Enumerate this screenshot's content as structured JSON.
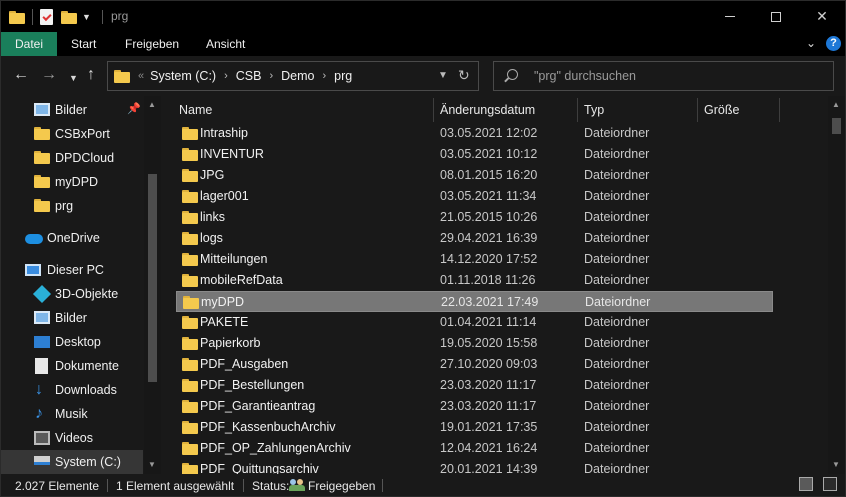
{
  "window": {
    "title": "prg",
    "min_label": "",
    "max_label": "",
    "close_label": "✕"
  },
  "ribbon": {
    "tabs": [
      {
        "label": "Datei",
        "active": true
      },
      {
        "label": "Start"
      },
      {
        "label": "Freigeben"
      },
      {
        "label": "Ansicht"
      }
    ],
    "help": "?"
  },
  "address": {
    "overflow": "«",
    "crumbs": [
      "System (C:)",
      "CSB",
      "Demo",
      "prg"
    ]
  },
  "search": {
    "placeholder": "\"prg\" durchsuchen"
  },
  "sidebar": {
    "items": [
      {
        "label": "Bilder",
        "icon": "pictures-icon",
        "pinned": true
      },
      {
        "label": "CSBxPort",
        "icon": "folder-icon"
      },
      {
        "label": "DPDCloud",
        "icon": "folder-icon"
      },
      {
        "label": "myDPD",
        "icon": "folder-icon"
      },
      {
        "label": "prg",
        "icon": "folder-icon"
      },
      {
        "label": "OneDrive",
        "icon": "cloud-icon"
      },
      {
        "label": "Dieser PC",
        "icon": "computer-icon"
      },
      {
        "label": "3D-Objekte",
        "icon": "3d-objects-icon"
      },
      {
        "label": "Bilder",
        "icon": "pictures-icon"
      },
      {
        "label": "Desktop",
        "icon": "desktop-icon"
      },
      {
        "label": "Dokumente",
        "icon": "documents-icon"
      },
      {
        "label": "Downloads",
        "icon": "downloads-icon"
      },
      {
        "label": "Musik",
        "icon": "music-icon"
      },
      {
        "label": "Videos",
        "icon": "videos-icon"
      },
      {
        "label": "System (C:)",
        "icon": "drive-icon",
        "selected": true
      }
    ]
  },
  "columns": {
    "name": "Name",
    "date": "Änderungsdatum",
    "type": "Typ",
    "size": "Größe"
  },
  "files": [
    {
      "name": "Intraship",
      "date": "03.05.2021 12:02",
      "type": "Dateiordner"
    },
    {
      "name": "INVENTUR",
      "date": "03.05.2021 10:12",
      "type": "Dateiordner"
    },
    {
      "name": "JPG",
      "date": "08.01.2015 16:20",
      "type": "Dateiordner"
    },
    {
      "name": "lager001",
      "date": "03.05.2021 11:34",
      "type": "Dateiordner"
    },
    {
      "name": "links",
      "date": "21.05.2015 10:26",
      "type": "Dateiordner"
    },
    {
      "name": "logs",
      "date": "29.04.2021 16:39",
      "type": "Dateiordner"
    },
    {
      "name": "Mitteilungen",
      "date": "14.12.2020 17:52",
      "type": "Dateiordner"
    },
    {
      "name": "mobileRefData",
      "date": "01.11.2018 11:26",
      "type": "Dateiordner"
    },
    {
      "name": "myDPD",
      "date": "22.03.2021 17:49",
      "type": "Dateiordner",
      "selected": true
    },
    {
      "name": "PAKETE",
      "date": "01.04.2021 11:14",
      "type": "Dateiordner"
    },
    {
      "name": "Papierkorb",
      "date": "19.05.2020 15:58",
      "type": "Dateiordner"
    },
    {
      "name": "PDF_Ausgaben",
      "date": "27.10.2020 09:03",
      "type": "Dateiordner"
    },
    {
      "name": "PDF_Bestellungen",
      "date": "23.03.2020 11:17",
      "type": "Dateiordner"
    },
    {
      "name": "PDF_Garantieantrag",
      "date": "23.03.2020 11:17",
      "type": "Dateiordner"
    },
    {
      "name": "PDF_KassenbuchArchiv",
      "date": "19.01.2021 17:35",
      "type": "Dateiordner"
    },
    {
      "name": "PDF_OP_ZahlungenArchiv",
      "date": "12.04.2021 16:24",
      "type": "Dateiordner"
    },
    {
      "name": "PDF_Quittungsarchiv",
      "date": "20.01.2021 14:39",
      "type": "Dateiordner"
    }
  ],
  "status": {
    "count": "2.027 Elemente",
    "selection": "1 Element ausgewählt",
    "state_label": "Status:",
    "state_value": "Freigegeben"
  },
  "colors": {
    "accent": "#1a7f5b",
    "folder": "#f4c94d",
    "selection": "#777777"
  }
}
